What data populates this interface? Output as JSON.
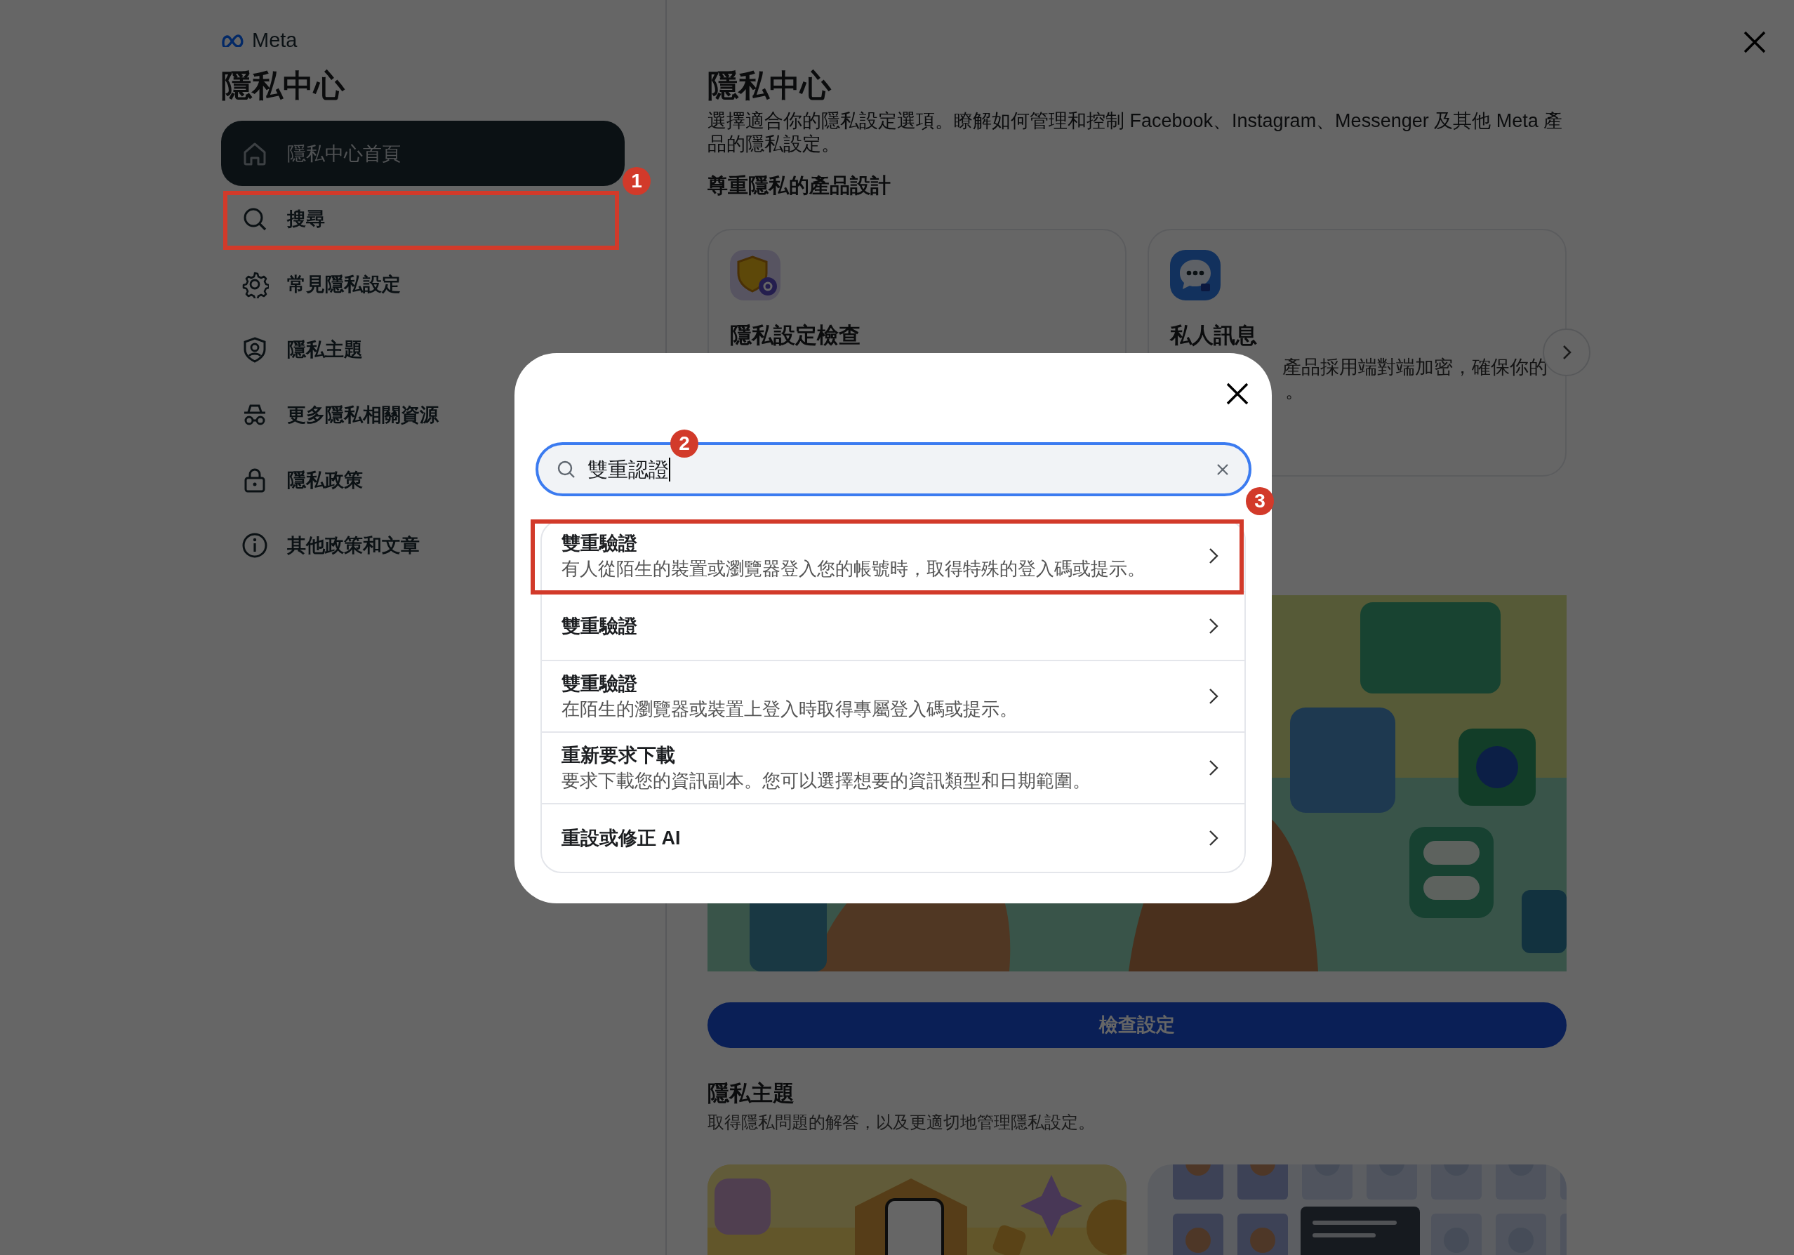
{
  "brand": "Meta",
  "sidebar": {
    "title": "隱私中心",
    "items": [
      {
        "label": "隱私中心首頁",
        "selected": true
      },
      {
        "label": "搜尋",
        "selected": false
      },
      {
        "label": "常見隱私設定",
        "selected": false
      },
      {
        "label": "隱私主題",
        "selected": false
      },
      {
        "label": "更多隱私相關資源",
        "selected": false
      },
      {
        "label": "隱私政策",
        "selected": false
      },
      {
        "label": "其他政策和文章",
        "selected": false
      }
    ]
  },
  "main": {
    "title": "隱私中心",
    "description": "選擇適合你的隱私設定選項。瞭解如何管理和控制 Facebook、Instagram、Messenger 及其他 Meta 產品的隱私設定。",
    "section_title": "尊重隱私的產品設計",
    "cards": [
      {
        "title": "隱私設定檢查"
      },
      {
        "title": "私人訊息",
        "description": [
          "產品採用端對端加密，確保你的",
          "。"
        ]
      }
    ],
    "button": "檢查設定",
    "topics_title": "隱私主題",
    "topics_description": "取得隱私問題的解答，以及更適切地管理隱私設定。"
  },
  "search_dialog": {
    "value": "雙重認證",
    "results": [
      {
        "title": "雙重驗證",
        "description": "有人從陌生的裝置或瀏覽器登入您的帳號時，取得特殊的登入碼或提示。"
      },
      {
        "title": "雙重驗證"
      },
      {
        "title": "雙重驗證",
        "description": "在陌生的瀏覽器或裝置上登入時取得專屬登入碼或提示。"
      },
      {
        "title": "重新要求下載",
        "description": "要求下載您的資訊副本。您可以選擇想要的資訊類型和日期範圍。"
      },
      {
        "title": "重設或修正 AI"
      }
    ]
  },
  "annotations": [
    {
      "label": "1"
    },
    {
      "label": "2"
    },
    {
      "label": "3"
    }
  ]
}
